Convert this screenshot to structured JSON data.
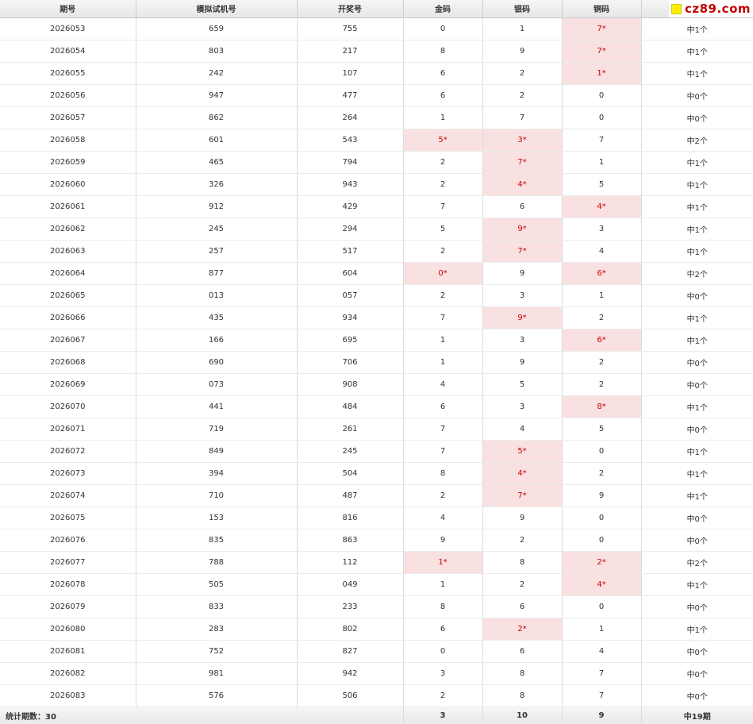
{
  "headers": [
    "期号",
    "模拟试机号",
    "开奖号",
    "金码",
    "银码",
    "铜码",
    ""
  ],
  "logo_text": "cz89.com",
  "highlight_color": "#f9e1e2",
  "hit_text_color": "#cc0000",
  "rows": [
    {
      "period": "2026053",
      "sim": "659",
      "draw": "755",
      "gold": "0",
      "silver": "1",
      "bronze": "7*",
      "result": "中1个",
      "hits": [
        "bronze"
      ]
    },
    {
      "period": "2026054",
      "sim": "803",
      "draw": "217",
      "gold": "8",
      "silver": "9",
      "bronze": "7*",
      "result": "中1个",
      "hits": [
        "bronze"
      ]
    },
    {
      "period": "2026055",
      "sim": "242",
      "draw": "107",
      "gold": "6",
      "silver": "2",
      "bronze": "1*",
      "result": "中1个",
      "hits": [
        "bronze"
      ]
    },
    {
      "period": "2026056",
      "sim": "947",
      "draw": "477",
      "gold": "6",
      "silver": "2",
      "bronze": "0",
      "result": "中0个",
      "hits": []
    },
    {
      "period": "2026057",
      "sim": "862",
      "draw": "264",
      "gold": "1",
      "silver": "7",
      "bronze": "0",
      "result": "中0个",
      "hits": []
    },
    {
      "period": "2026058",
      "sim": "601",
      "draw": "543",
      "gold": "5*",
      "silver": "3*",
      "bronze": "7",
      "result": "中2个",
      "hits": [
        "gold",
        "silver"
      ]
    },
    {
      "period": "2026059",
      "sim": "465",
      "draw": "794",
      "gold": "2",
      "silver": "7*",
      "bronze": "1",
      "result": "中1个",
      "hits": [
        "silver"
      ]
    },
    {
      "period": "2026060",
      "sim": "326",
      "draw": "943",
      "gold": "2",
      "silver": "4*",
      "bronze": "5",
      "result": "中1个",
      "hits": [
        "silver"
      ]
    },
    {
      "period": "2026061",
      "sim": "912",
      "draw": "429",
      "gold": "7",
      "silver": "6",
      "bronze": "4*",
      "result": "中1个",
      "hits": [
        "bronze"
      ]
    },
    {
      "period": "2026062",
      "sim": "245",
      "draw": "294",
      "gold": "5",
      "silver": "9*",
      "bronze": "3",
      "result": "中1个",
      "hits": [
        "silver"
      ]
    },
    {
      "period": "2026063",
      "sim": "257",
      "draw": "517",
      "gold": "2",
      "silver": "7*",
      "bronze": "4",
      "result": "中1个",
      "hits": [
        "silver"
      ]
    },
    {
      "period": "2026064",
      "sim": "877",
      "draw": "604",
      "gold": "0*",
      "silver": "9",
      "bronze": "6*",
      "result": "中2个",
      "hits": [
        "gold",
        "bronze"
      ]
    },
    {
      "period": "2026065",
      "sim": "013",
      "draw": "057",
      "gold": "2",
      "silver": "3",
      "bronze": "1",
      "result": "中0个",
      "hits": []
    },
    {
      "period": "2026066",
      "sim": "435",
      "draw": "934",
      "gold": "7",
      "silver": "9*",
      "bronze": "2",
      "result": "中1个",
      "hits": [
        "silver"
      ]
    },
    {
      "period": "2026067",
      "sim": "166",
      "draw": "695",
      "gold": "1",
      "silver": "3",
      "bronze": "6*",
      "result": "中1个",
      "hits": [
        "bronze"
      ]
    },
    {
      "period": "2026068",
      "sim": "690",
      "draw": "706",
      "gold": "1",
      "silver": "9",
      "bronze": "2",
      "result": "中0个",
      "hits": []
    },
    {
      "period": "2026069",
      "sim": "073",
      "draw": "908",
      "gold": "4",
      "silver": "5",
      "bronze": "2",
      "result": "中0个",
      "hits": []
    },
    {
      "period": "2026070",
      "sim": "441",
      "draw": "484",
      "gold": "6",
      "silver": "3",
      "bronze": "8*",
      "result": "中1个",
      "hits": [
        "bronze"
      ]
    },
    {
      "period": "2026071",
      "sim": "719",
      "draw": "261",
      "gold": "7",
      "silver": "4",
      "bronze": "5",
      "result": "中0个",
      "hits": []
    },
    {
      "period": "2026072",
      "sim": "849",
      "draw": "245",
      "gold": "7",
      "silver": "5*",
      "bronze": "0",
      "result": "中1个",
      "hits": [
        "silver"
      ]
    },
    {
      "period": "2026073",
      "sim": "394",
      "draw": "504",
      "gold": "8",
      "silver": "4*",
      "bronze": "2",
      "result": "中1个",
      "hits": [
        "silver"
      ]
    },
    {
      "period": "2026074",
      "sim": "710",
      "draw": "487",
      "gold": "2",
      "silver": "7*",
      "bronze": "9",
      "result": "中1个",
      "hits": [
        "silver"
      ]
    },
    {
      "period": "2026075",
      "sim": "153",
      "draw": "816",
      "gold": "4",
      "silver": "9",
      "bronze": "0",
      "result": "中0个",
      "hits": []
    },
    {
      "period": "2026076",
      "sim": "835",
      "draw": "863",
      "gold": "9",
      "silver": "2",
      "bronze": "0",
      "result": "中0个",
      "hits": []
    },
    {
      "period": "2026077",
      "sim": "788",
      "draw": "112",
      "gold": "1*",
      "silver": "8",
      "bronze": "2*",
      "result": "中2个",
      "hits": [
        "gold",
        "bronze"
      ]
    },
    {
      "period": "2026078",
      "sim": "505",
      "draw": "049",
      "gold": "1",
      "silver": "2",
      "bronze": "4*",
      "result": "中1个",
      "hits": [
        "bronze"
      ]
    },
    {
      "period": "2026079",
      "sim": "833",
      "draw": "233",
      "gold": "8",
      "silver": "6",
      "bronze": "0",
      "result": "中0个",
      "hits": []
    },
    {
      "period": "2026080",
      "sim": "283",
      "draw": "802",
      "gold": "6",
      "silver": "2*",
      "bronze": "1",
      "result": "中1个",
      "hits": [
        "silver"
      ]
    },
    {
      "period": "2026081",
      "sim": "752",
      "draw": "827",
      "gold": "0",
      "silver": "6",
      "bronze": "4",
      "result": "中0个",
      "hits": []
    },
    {
      "period": "2026082",
      "sim": "981",
      "draw": "942",
      "gold": "3",
      "silver": "8",
      "bronze": "7",
      "result": "中0个",
      "hits": []
    },
    {
      "period": "2026083",
      "sim": "576",
      "draw": "506",
      "gold": "2",
      "silver": "8",
      "bronze": "7",
      "result": "中0个",
      "hits": []
    }
  ],
  "summary": {
    "label": "统计期数：30",
    "gold_total": "3",
    "silver_total": "10",
    "bronze_total": "9",
    "result_total": "中19期"
  }
}
